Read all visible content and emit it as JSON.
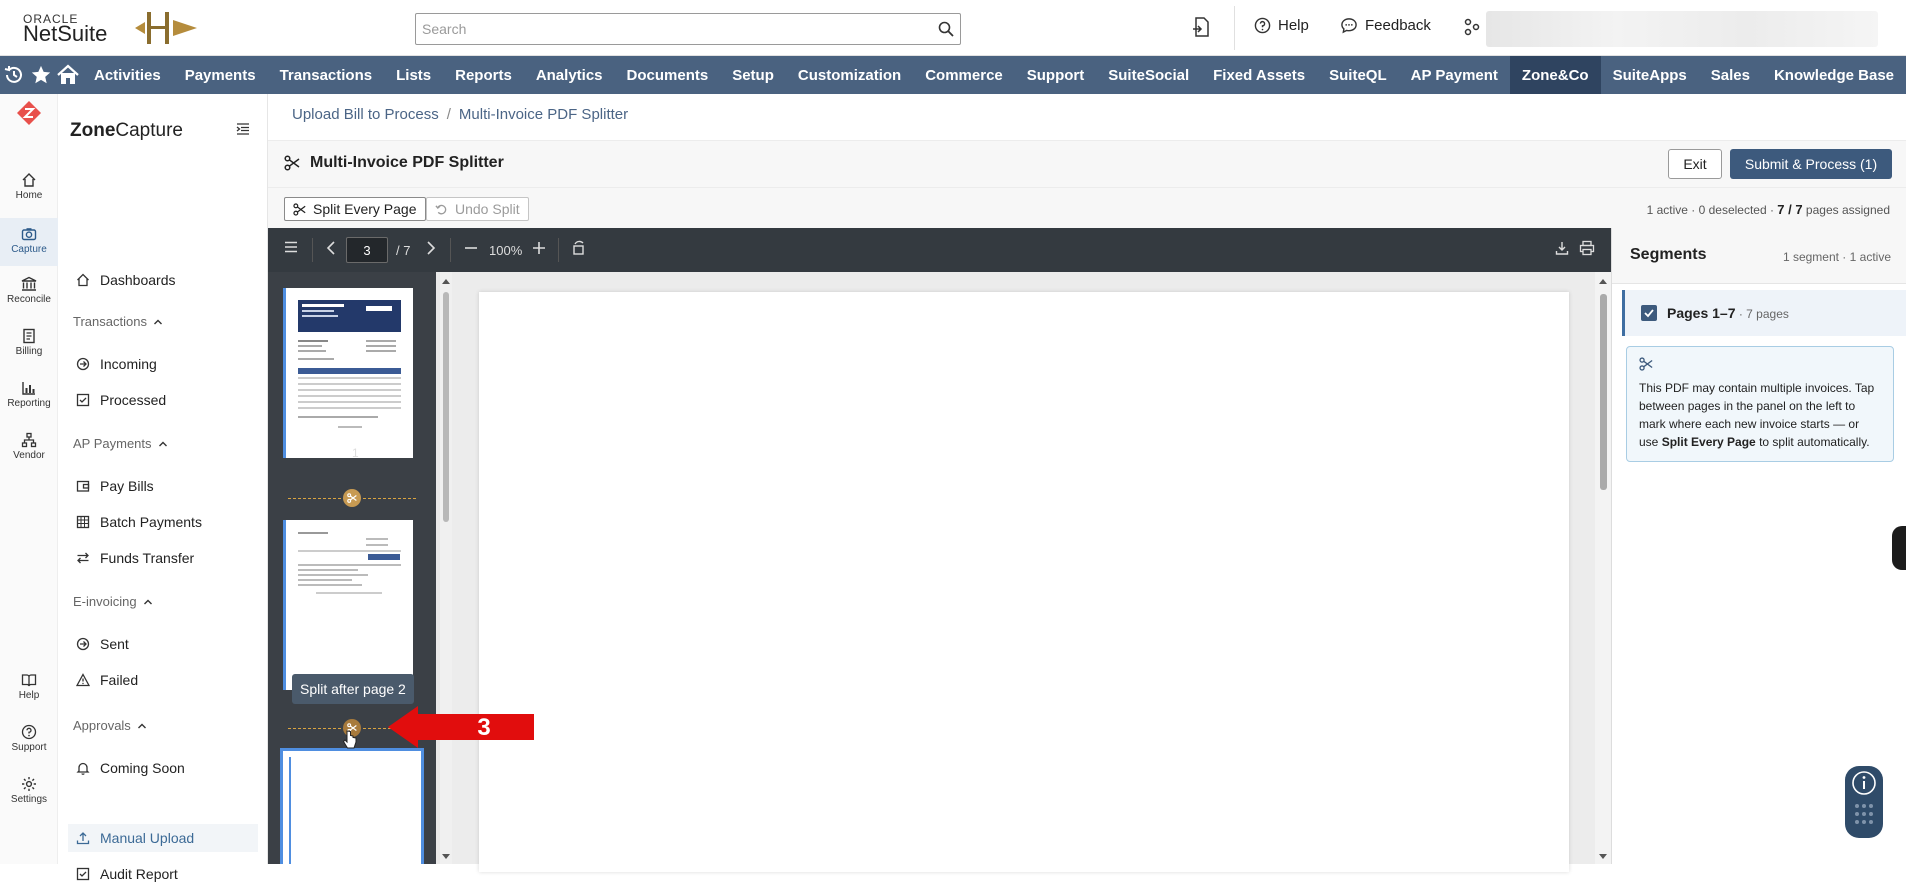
{
  "topbar": {
    "logo_oracle": "ORACLE",
    "logo_netsuite": "NetSuite",
    "search_placeholder": "Search",
    "help_label": "Help",
    "feedback_label": "Feedback"
  },
  "nav": {
    "items": [
      "Activities",
      "Payments",
      "Transactions",
      "Lists",
      "Reports",
      "Analytics",
      "Documents",
      "Setup",
      "Customization",
      "Commerce",
      "Support",
      "SuiteSocial",
      "Fixed Assets",
      "SuiteQL",
      "AP Payment",
      "Zone&Co",
      "SuiteApps",
      "Sales",
      "Knowledge Base"
    ],
    "active": "Zone&Co"
  },
  "rail": {
    "items": [
      "Home",
      "Capture",
      "Reconcile",
      "Billing",
      "Reporting",
      "Vendor",
      "Help",
      "Support",
      "Settings"
    ]
  },
  "sidebar": {
    "brand_bold": "Zone",
    "brand_rest": "Capture",
    "dashboards": "Dashboards",
    "sec_transactions": "Transactions",
    "incoming": "Incoming",
    "processed": "Processed",
    "sec_ap": "AP Payments",
    "pay_bills": "Pay Bills",
    "batch_payments": "Batch Payments",
    "funds_transfer": "Funds Transfer",
    "sec_einvoicing": "E-invoicing",
    "sent": "Sent",
    "failed": "Failed",
    "sec_approvals": "Approvals",
    "coming_soon": "Coming Soon",
    "manual_upload": "Manual Upload",
    "audit_report": "Audit Report"
  },
  "breadcrumb": {
    "parent": "Upload Bill to Process",
    "sep": "/",
    "current": "Multi-Invoice PDF Splitter"
  },
  "header": {
    "title": "Multi-Invoice PDF Splitter",
    "exit_label": "Exit",
    "submit_label": "Submit & Process (1)"
  },
  "toolbar": {
    "split_every_page": "Split Every Page",
    "undo_split": "Undo Split",
    "status_prefix": "1 active · 0 deselected · ",
    "status_pages": "7 / 7",
    "status_suffix": " pages assigned"
  },
  "viewer": {
    "current_page": "3",
    "total_pages": "/ 7",
    "zoom": "100%",
    "thumb1_number": "1",
    "tooltip": "Split after page 2"
  },
  "segments": {
    "title": "Segments",
    "count": "1 segment · 1 active",
    "item_label": "Pages 1–7",
    "item_sub": " · 7 pages",
    "info_text_1": "This PDF may contain multiple invoices. Tap between pages in the panel on the left to mark where each new invoice starts — or use ",
    "info_bold": "Split Every Page",
    "info_text_2": " to split automatically."
  },
  "annotation": {
    "step_number": "3"
  },
  "colors": {
    "nav_bg": "#4a6280",
    "nav_active": "#2f4460",
    "primary_button": "#3d5a7d",
    "thumb_highlight": "#4f8ee0",
    "split_marker": "#c79a52",
    "callout_red": "#e10d0d"
  }
}
